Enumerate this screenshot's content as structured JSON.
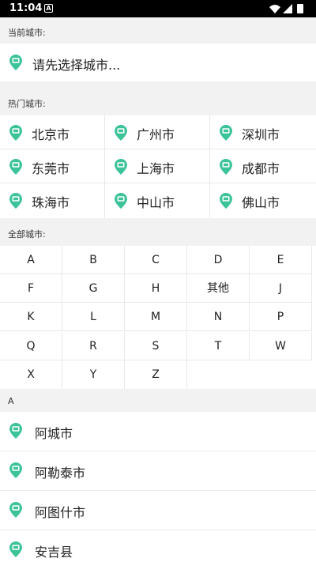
{
  "status_bar": {
    "time": "11:04",
    "notification_glyph": "A"
  },
  "current_city": {
    "label": "当前城市:",
    "placeholder": "请先选择城市..."
  },
  "hot_cities": {
    "label": "热门城市:",
    "items": [
      "北京市",
      "广州市",
      "深圳市",
      "东莞市",
      "上海市",
      "成都市",
      "珠海市",
      "中山市",
      "佛山市"
    ]
  },
  "all_cities": {
    "label": "全部城市:",
    "letters": [
      "A",
      "B",
      "C",
      "D",
      "E",
      "F",
      "G",
      "H",
      "其他",
      "J",
      "K",
      "L",
      "M",
      "N",
      "P",
      "Q",
      "R",
      "S",
      "T",
      "W",
      "X",
      "Y",
      "Z"
    ]
  },
  "city_list": {
    "section_header": "A",
    "items": [
      "阿城市",
      "阿勒泰市",
      "阿图什市",
      "安吉县"
    ]
  },
  "colors": {
    "accent": "#3cc39a",
    "background": "#f2f2f2"
  },
  "icons": {
    "city_pin": "location-pin-icon"
  }
}
